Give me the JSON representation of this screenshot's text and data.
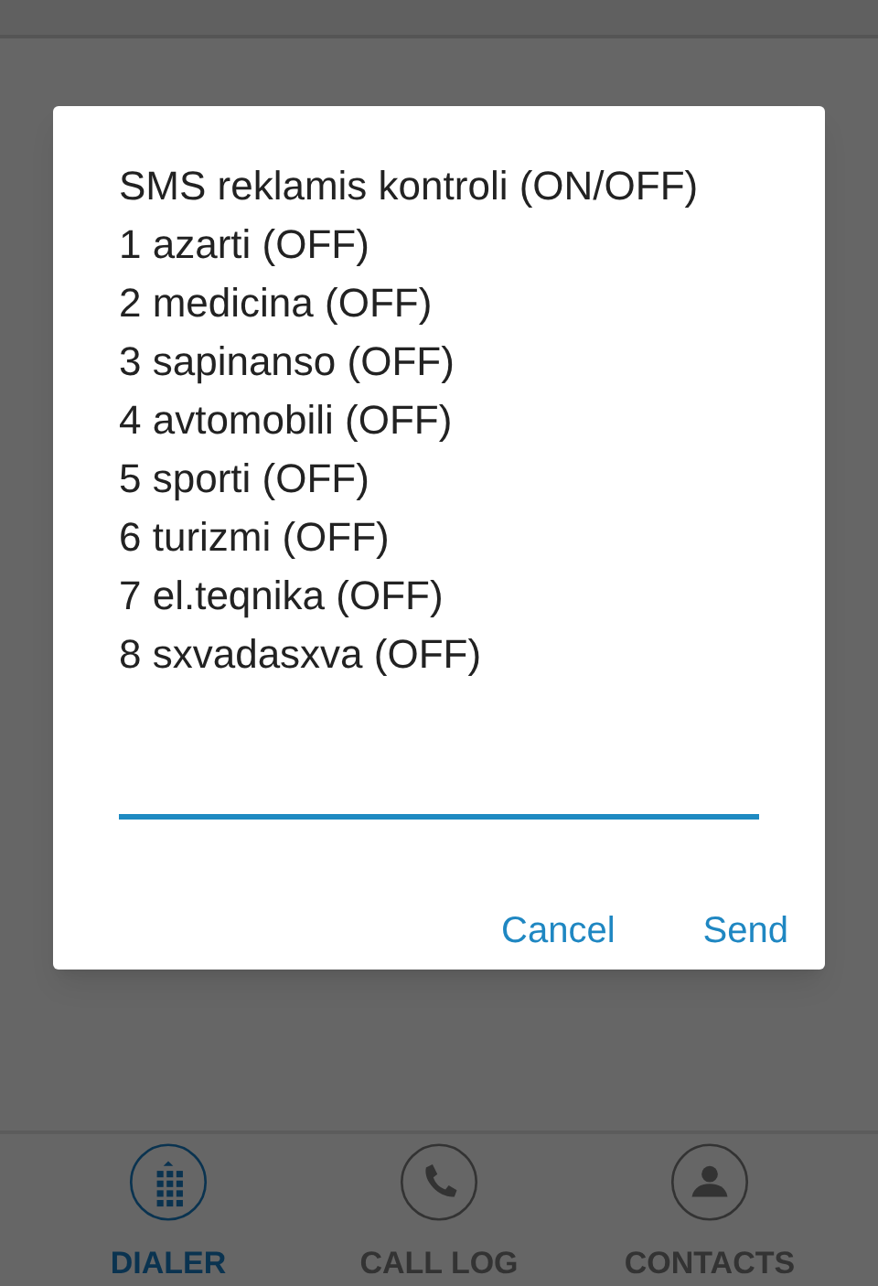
{
  "dialog": {
    "lines": [
      "SMS reklamis kontroli (ON/OFF)",
      "1 azarti (OFF)",
      "2 medicina (OFF)",
      "3 sapinanso (OFF)",
      "4 avtomobili (OFF)",
      "5 sporti (OFF)",
      "6 turizmi (OFF)",
      "7 el.teqnika (OFF)",
      "8 sxvadasxva (OFF)"
    ],
    "buttons": [
      "Cancel",
      "Send"
    ]
  },
  "tabs": [
    {
      "label": "DIALER",
      "kind": "dialpad",
      "selected": true
    },
    {
      "label": "CALL LOG",
      "kind": "phone",
      "selected": false
    },
    {
      "label": "CONTACTS",
      "kind": "person",
      "selected": false
    }
  ]
}
